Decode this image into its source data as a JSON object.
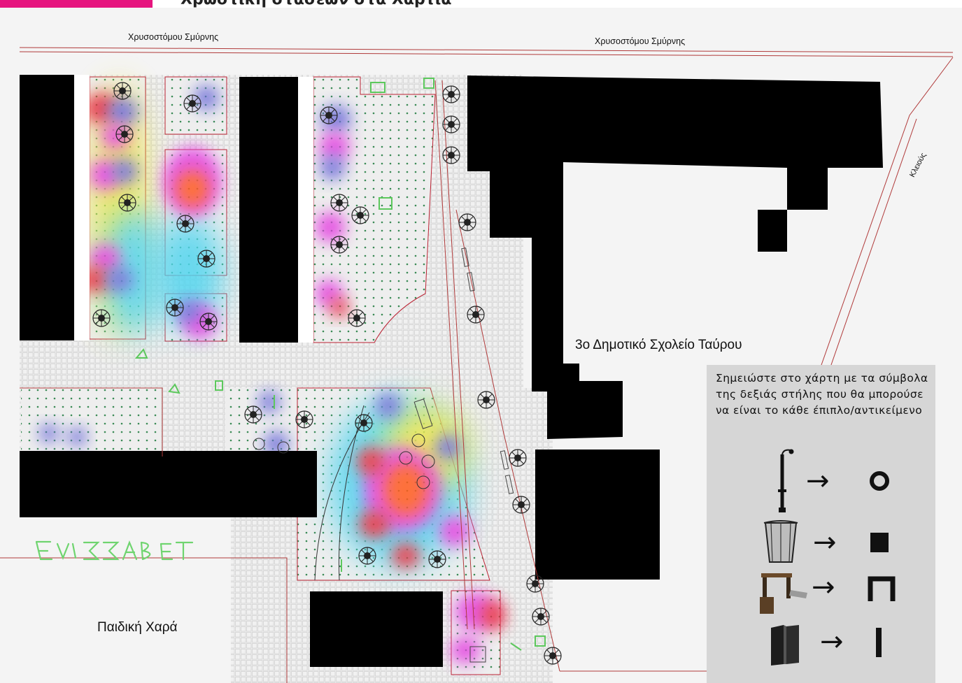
{
  "header": {
    "title": "Χρωστική στάσεων στα Χαρτιά",
    "accent_color": "#e6157f"
  },
  "map": {
    "street_labels": {
      "top_left": "Χρυσοστόμου Σμύρνης",
      "top_right": "Χρυσοστόμου Σμύρνης",
      "right": "Κλειούς"
    },
    "places": {
      "school": "3ο Δημοτικό Σχολείο Ταύρου",
      "playground": "Παιδική Χαρά"
    },
    "handwritten_note": "ΕΛΙΣΣΑΒΕΤ",
    "heatmap_colors": {
      "hot": "#ff5a1f",
      "red": "#e82a3a",
      "magenta": "#e43fe0",
      "blue": "#6a6ad8",
      "cyan": "#4fd4ee",
      "yellow": "#ede64a"
    }
  },
  "legend": {
    "instruction": "Σημειώστε στο χάρτη με τα σύμβολα της δεξιάς στήλης που θα μπορούσε να είναι το κάθε έπιπλο/αντικείμενο",
    "items": [
      {
        "object": "lamp-post",
        "symbol": "circle"
      },
      {
        "object": "litter-bin",
        "symbol": "filled-square"
      },
      {
        "object": "bench",
        "symbol": "bench-shape"
      },
      {
        "object": "bollard",
        "symbol": "vertical-bar"
      }
    ]
  }
}
